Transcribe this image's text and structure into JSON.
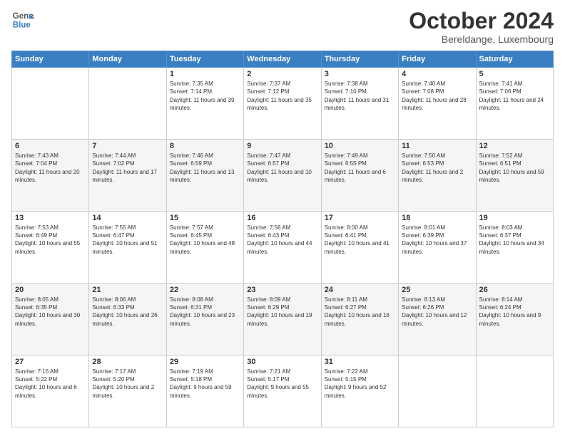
{
  "header": {
    "logo_line1": "General",
    "logo_line2": "Blue",
    "title": "October 2024",
    "subtitle": "Bereldange, Luxembourg"
  },
  "weekdays": [
    "Sunday",
    "Monday",
    "Tuesday",
    "Wednesday",
    "Thursday",
    "Friday",
    "Saturday"
  ],
  "weeks": [
    [
      {
        "day": "",
        "sunrise": "",
        "sunset": "",
        "daylight": ""
      },
      {
        "day": "",
        "sunrise": "",
        "sunset": "",
        "daylight": ""
      },
      {
        "day": "1",
        "sunrise": "Sunrise: 7:35 AM",
        "sunset": "Sunset: 7:14 PM",
        "daylight": "Daylight: 11 hours and 39 minutes."
      },
      {
        "day": "2",
        "sunrise": "Sunrise: 7:37 AM",
        "sunset": "Sunset: 7:12 PM",
        "daylight": "Daylight: 11 hours and 35 minutes."
      },
      {
        "day": "3",
        "sunrise": "Sunrise: 7:38 AM",
        "sunset": "Sunset: 7:10 PM",
        "daylight": "Daylight: 11 hours and 31 minutes."
      },
      {
        "day": "4",
        "sunrise": "Sunrise: 7:40 AM",
        "sunset": "Sunset: 7:08 PM",
        "daylight": "Daylight: 11 hours and 28 minutes."
      },
      {
        "day": "5",
        "sunrise": "Sunrise: 7:41 AM",
        "sunset": "Sunset: 7:06 PM",
        "daylight": "Daylight: 11 hours and 24 minutes."
      }
    ],
    [
      {
        "day": "6",
        "sunrise": "Sunrise: 7:43 AM",
        "sunset": "Sunset: 7:04 PM",
        "daylight": "Daylight: 11 hours and 20 minutes."
      },
      {
        "day": "7",
        "sunrise": "Sunrise: 7:44 AM",
        "sunset": "Sunset: 7:02 PM",
        "daylight": "Daylight: 11 hours and 17 minutes."
      },
      {
        "day": "8",
        "sunrise": "Sunrise: 7:46 AM",
        "sunset": "Sunset: 6:59 PM",
        "daylight": "Daylight: 11 hours and 13 minutes."
      },
      {
        "day": "9",
        "sunrise": "Sunrise: 7:47 AM",
        "sunset": "Sunset: 6:57 PM",
        "daylight": "Daylight: 11 hours and 10 minutes."
      },
      {
        "day": "10",
        "sunrise": "Sunrise: 7:49 AM",
        "sunset": "Sunset: 6:55 PM",
        "daylight": "Daylight: 11 hours and 6 minutes."
      },
      {
        "day": "11",
        "sunrise": "Sunrise: 7:50 AM",
        "sunset": "Sunset: 6:53 PM",
        "daylight": "Daylight: 11 hours and 2 minutes."
      },
      {
        "day": "12",
        "sunrise": "Sunrise: 7:52 AM",
        "sunset": "Sunset: 6:51 PM",
        "daylight": "Daylight: 10 hours and 59 minutes."
      }
    ],
    [
      {
        "day": "13",
        "sunrise": "Sunrise: 7:53 AM",
        "sunset": "Sunset: 6:49 PM",
        "daylight": "Daylight: 10 hours and 55 minutes."
      },
      {
        "day": "14",
        "sunrise": "Sunrise: 7:55 AM",
        "sunset": "Sunset: 6:47 PM",
        "daylight": "Daylight: 10 hours and 51 minutes."
      },
      {
        "day": "15",
        "sunrise": "Sunrise: 7:57 AM",
        "sunset": "Sunset: 6:45 PM",
        "daylight": "Daylight: 10 hours and 48 minutes."
      },
      {
        "day": "16",
        "sunrise": "Sunrise: 7:58 AM",
        "sunset": "Sunset: 6:43 PM",
        "daylight": "Daylight: 10 hours and 44 minutes."
      },
      {
        "day": "17",
        "sunrise": "Sunrise: 8:00 AM",
        "sunset": "Sunset: 6:41 PM",
        "daylight": "Daylight: 10 hours and 41 minutes."
      },
      {
        "day": "18",
        "sunrise": "Sunrise: 8:01 AM",
        "sunset": "Sunset: 6:39 PM",
        "daylight": "Daylight: 10 hours and 37 minutes."
      },
      {
        "day": "19",
        "sunrise": "Sunrise: 8:03 AM",
        "sunset": "Sunset: 6:37 PM",
        "daylight": "Daylight: 10 hours and 34 minutes."
      }
    ],
    [
      {
        "day": "20",
        "sunrise": "Sunrise: 8:05 AM",
        "sunset": "Sunset: 6:35 PM",
        "daylight": "Daylight: 10 hours and 30 minutes."
      },
      {
        "day": "21",
        "sunrise": "Sunrise: 8:06 AM",
        "sunset": "Sunset: 6:33 PM",
        "daylight": "Daylight: 10 hours and 26 minutes."
      },
      {
        "day": "22",
        "sunrise": "Sunrise: 8:08 AM",
        "sunset": "Sunset: 6:31 PM",
        "daylight": "Daylight: 10 hours and 23 minutes."
      },
      {
        "day": "23",
        "sunrise": "Sunrise: 8:09 AM",
        "sunset": "Sunset: 6:29 PM",
        "daylight": "Daylight: 10 hours and 19 minutes."
      },
      {
        "day": "24",
        "sunrise": "Sunrise: 8:11 AM",
        "sunset": "Sunset: 6:27 PM",
        "daylight": "Daylight: 10 hours and 16 minutes."
      },
      {
        "day": "25",
        "sunrise": "Sunrise: 8:13 AM",
        "sunset": "Sunset: 6:26 PM",
        "daylight": "Daylight: 10 hours and 12 minutes."
      },
      {
        "day": "26",
        "sunrise": "Sunrise: 8:14 AM",
        "sunset": "Sunset: 6:24 PM",
        "daylight": "Daylight: 10 hours and 9 minutes."
      }
    ],
    [
      {
        "day": "27",
        "sunrise": "Sunrise: 7:16 AM",
        "sunset": "Sunset: 5:22 PM",
        "daylight": "Daylight: 10 hours and 6 minutes."
      },
      {
        "day": "28",
        "sunrise": "Sunrise: 7:17 AM",
        "sunset": "Sunset: 5:20 PM",
        "daylight": "Daylight: 10 hours and 2 minutes."
      },
      {
        "day": "29",
        "sunrise": "Sunrise: 7:19 AM",
        "sunset": "Sunset: 5:18 PM",
        "daylight": "Daylight: 9 hours and 59 minutes."
      },
      {
        "day": "30",
        "sunrise": "Sunrise: 7:21 AM",
        "sunset": "Sunset: 5:17 PM",
        "daylight": "Daylight: 9 hours and 55 minutes."
      },
      {
        "day": "31",
        "sunrise": "Sunrise: 7:22 AM",
        "sunset": "Sunset: 5:15 PM",
        "daylight": "Daylight: 9 hours and 52 minutes."
      },
      {
        "day": "",
        "sunrise": "",
        "sunset": "",
        "daylight": ""
      },
      {
        "day": "",
        "sunrise": "",
        "sunset": "",
        "daylight": ""
      }
    ]
  ]
}
